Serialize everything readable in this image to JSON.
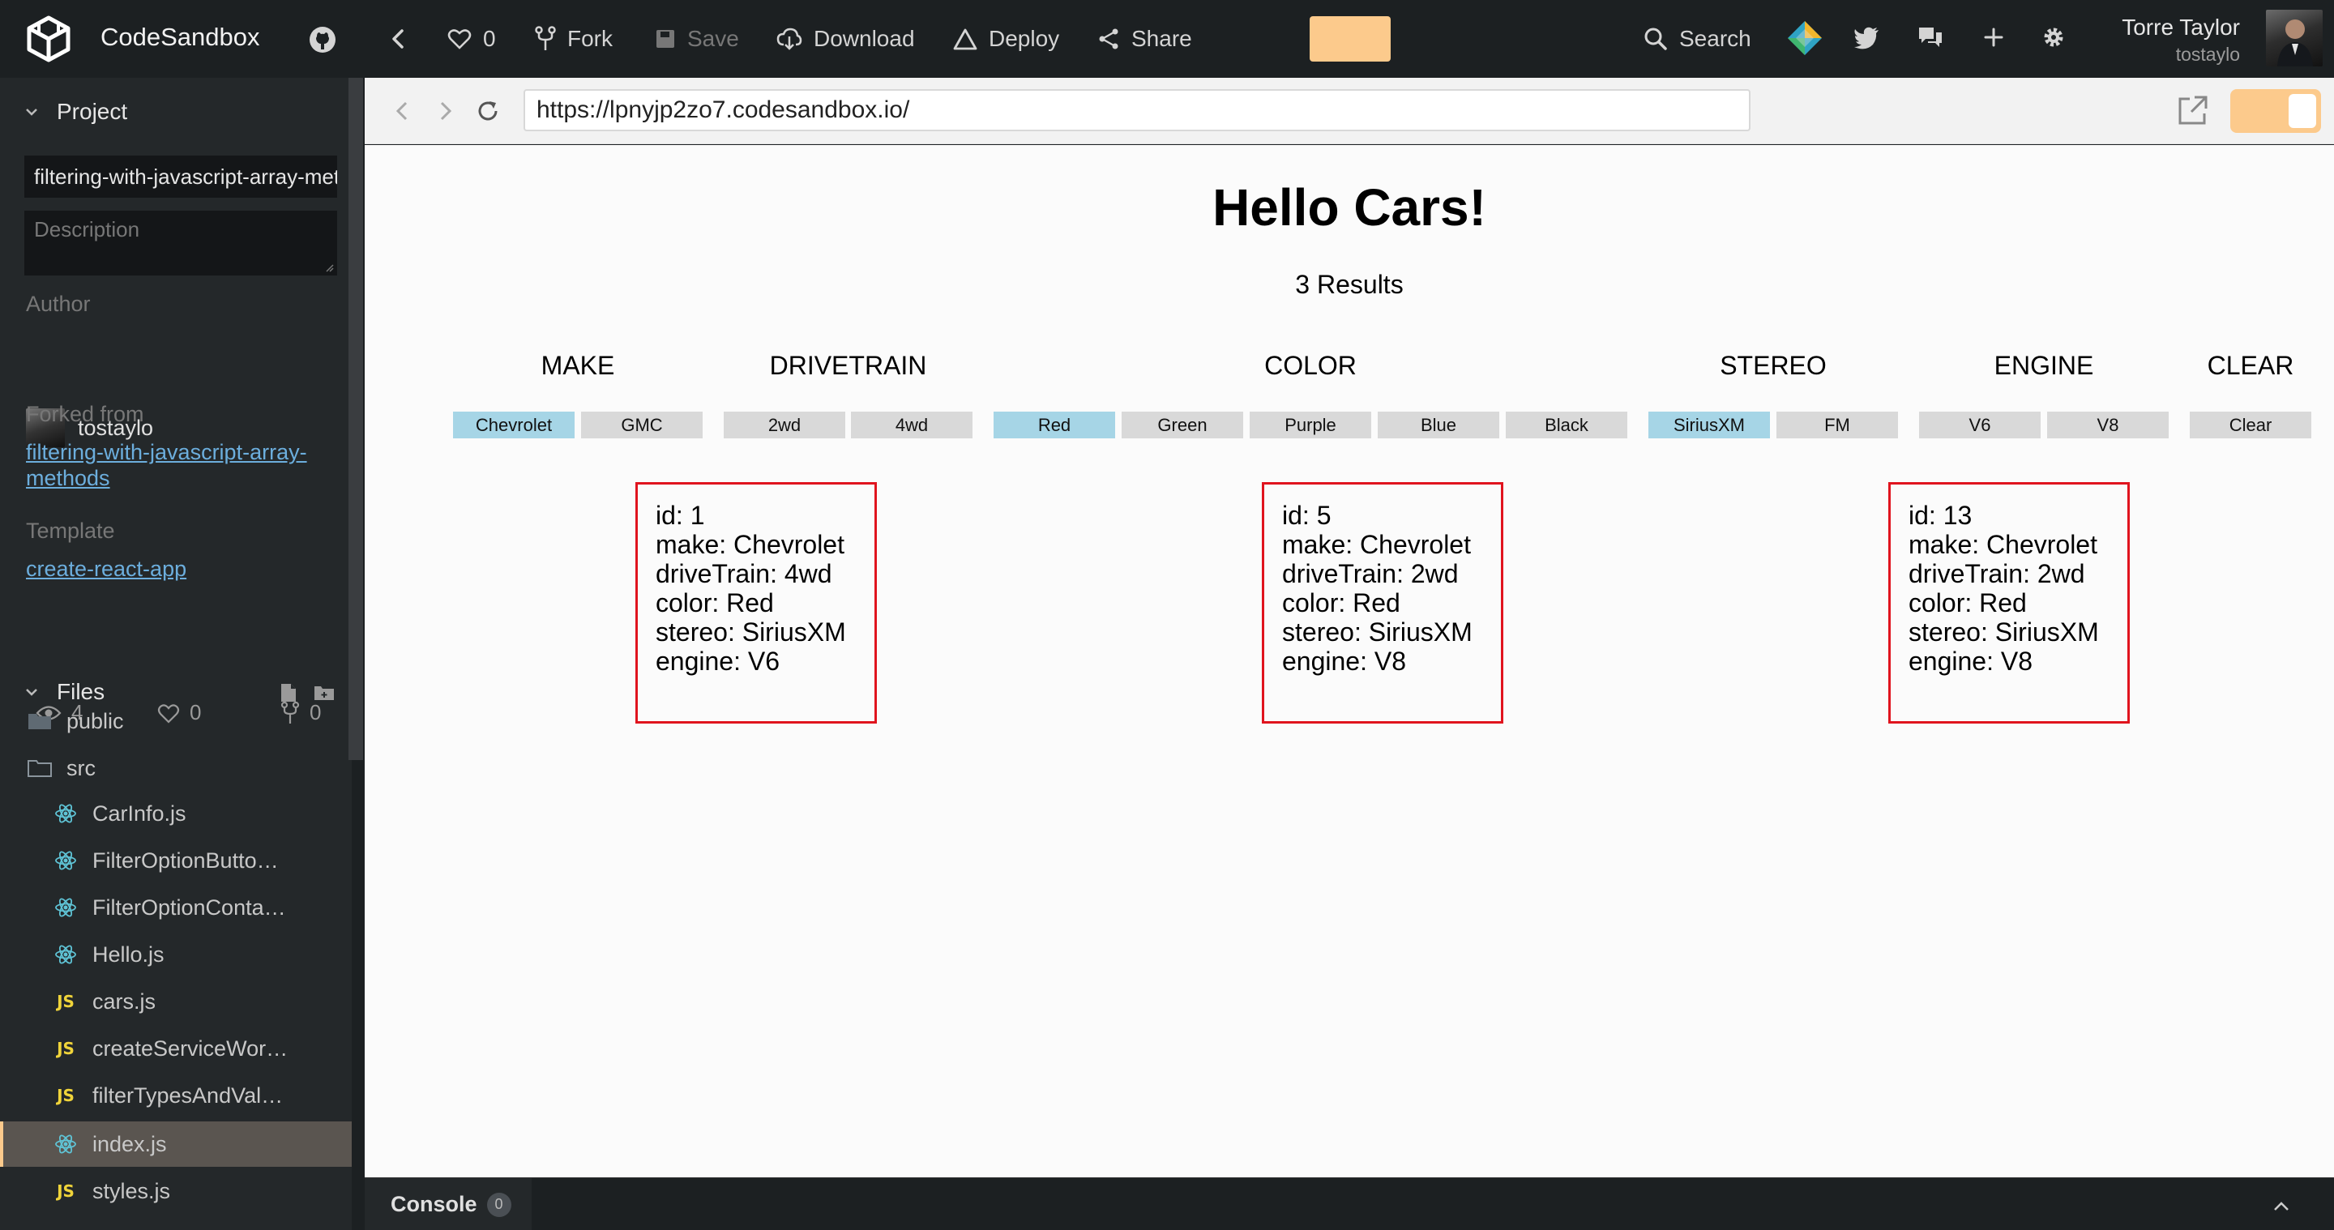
{
  "app": {
    "name": "CodeSandbox"
  },
  "toolbar": {
    "like_count": "0",
    "fork_label": "Fork",
    "save_label": "Save",
    "download_label": "Download",
    "deploy_label": "Deploy",
    "share_label": "Share",
    "search_label": "Search"
  },
  "user": {
    "name": "Torre Taylor",
    "handle": "tostaylo"
  },
  "sidebar": {
    "project_label": "Project",
    "project_name": "filtering-with-javascript-array-methods",
    "description_placeholder": "Description",
    "author_label": "Author",
    "author_name": "tostaylo",
    "forked_label": "Forked from",
    "forked_link": "filtering-with-javascript-array-methods",
    "template_label": "Template",
    "template_link": "create-react-app",
    "stats": {
      "views": "4",
      "likes": "0",
      "forks": "0"
    },
    "files_label": "Files",
    "files": [
      {
        "name": "public",
        "type": "folder"
      },
      {
        "name": "src",
        "type": "folder-open"
      },
      {
        "name": "CarInfo.js",
        "type": "react"
      },
      {
        "name": "FilterOptionButto…",
        "type": "react"
      },
      {
        "name": "FilterOptionConta…",
        "type": "react"
      },
      {
        "name": "Hello.js",
        "type": "react"
      },
      {
        "name": "cars.js",
        "type": "js"
      },
      {
        "name": "createServiceWor…",
        "type": "js"
      },
      {
        "name": "filterTypesAndVal…",
        "type": "js"
      },
      {
        "name": "index.js",
        "type": "react"
      },
      {
        "name": "styles.js",
        "type": "js"
      }
    ]
  },
  "browser": {
    "url": "https://lpnyjp2zo7.codesandbox.io/"
  },
  "preview": {
    "heading": "Hello Cars!",
    "results": "3 Results",
    "filters": [
      {
        "title": "MAKE",
        "options": [
          {
            "label": "Chevrolet",
            "active": true
          },
          {
            "label": "GMC",
            "active": false
          }
        ]
      },
      {
        "title": "DRIVETRAIN",
        "options": [
          {
            "label": "2wd",
            "active": false
          },
          {
            "label": "4wd",
            "active": false
          }
        ]
      },
      {
        "title": "COLOR",
        "options": [
          {
            "label": "Red",
            "active": true
          },
          {
            "label": "Green",
            "active": false
          },
          {
            "label": "Purple",
            "active": false
          },
          {
            "label": "Blue",
            "active": false
          },
          {
            "label": "Black",
            "active": false
          }
        ]
      },
      {
        "title": "STEREO",
        "options": [
          {
            "label": "SiriusXM",
            "active": true
          },
          {
            "label": "FM",
            "active": false
          }
        ]
      },
      {
        "title": "ENGINE",
        "options": [
          {
            "label": "V6",
            "active": false
          },
          {
            "label": "V8",
            "active": false
          }
        ]
      },
      {
        "title": "CLEAR",
        "options": [
          {
            "label": "Clear",
            "active": false
          }
        ]
      }
    ],
    "cars": [
      {
        "lines": [
          "id: 1",
          "make: Chevrolet",
          "driveTrain: 4wd",
          "color: Red",
          "stereo: SiriusXM",
          "engine: V6"
        ]
      },
      {
        "lines": [
          "id: 5",
          "make: Chevrolet",
          "driveTrain: 2wd",
          "color: Red",
          "stereo: SiriusXM",
          "engine: V8"
        ]
      },
      {
        "lines": [
          "id: 13",
          "make: Chevrolet",
          "driveTrain: 2wd",
          "color: Red",
          "stereo: SiriusXM",
          "engine: V8"
        ]
      }
    ]
  },
  "console": {
    "label": "Console",
    "count": "0"
  },
  "colors": {
    "accent": "#fcca8c",
    "active_filter": "#a6d5e6",
    "card_border": "#e0141e",
    "link": "#6caedd"
  }
}
